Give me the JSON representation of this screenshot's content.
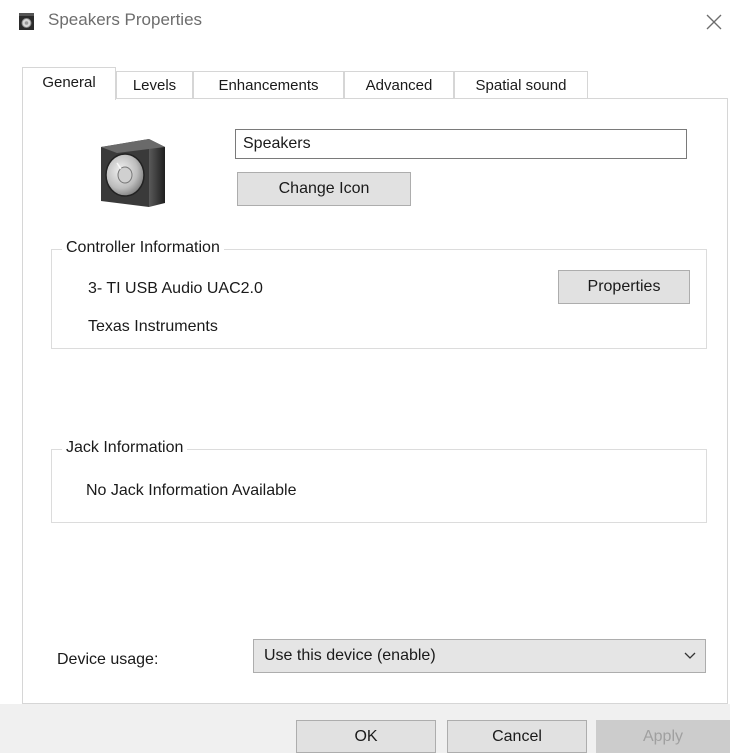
{
  "window": {
    "title": "Speakers Properties"
  },
  "tabs": [
    {
      "label": "General",
      "active": true
    },
    {
      "label": "Levels",
      "active": false
    },
    {
      "label": "Enhancements",
      "active": false
    },
    {
      "label": "Advanced",
      "active": false
    },
    {
      "label": "Spatial sound",
      "active": false
    }
  ],
  "general": {
    "device_name": "Speakers",
    "change_icon_label": "Change Icon",
    "controller": {
      "title": "Controller Information",
      "device": "3- TI USB Audio UAC2.0",
      "manufacturer": "Texas Instruments",
      "properties_label": "Properties"
    },
    "jack": {
      "title": "Jack Information",
      "status": "No Jack Information Available"
    },
    "device_usage": {
      "label": "Device usage:",
      "selected": "Use this device (enable)"
    }
  },
  "buttons": {
    "ok": "OK",
    "cancel": "Cancel",
    "apply": "Apply"
  },
  "colors": {
    "button_bg": "#e1e1e1",
    "disabled_text": "#a0a0a0",
    "footer_bg": "#f0f0f0"
  }
}
